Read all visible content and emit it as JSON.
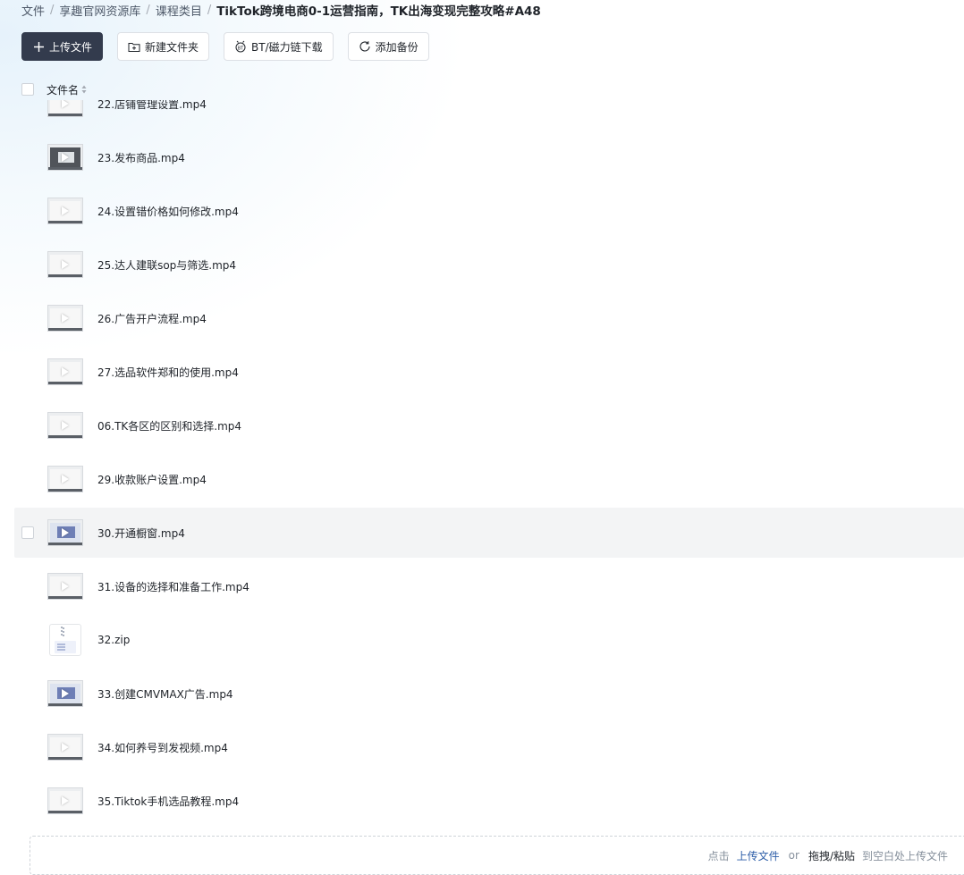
{
  "breadcrumb": {
    "items": [
      "文件",
      "享趣官网资源库",
      "课程类目"
    ],
    "current": "TikTok跨境电商0-1运营指南，TK出海变现完整攻略#A48",
    "separator": "/"
  },
  "toolbar": {
    "upload": "上传文件",
    "new_folder": "新建文件夹",
    "bt_download": "BT/磁力链下载",
    "add_backup": "添加备份"
  },
  "list_header": {
    "name_label": "文件名"
  },
  "files": [
    {
      "name": "22.店铺管理设置.mp4",
      "thumb": "light"
    },
    {
      "name": "23.发布商品.mp4",
      "thumb": "dark"
    },
    {
      "name": "24.设置错价格如何修改.mp4",
      "thumb": "light"
    },
    {
      "name": "25.达人建联sop与筛选.mp4",
      "thumb": "light"
    },
    {
      "name": "26.广告开户流程.mp4",
      "thumb": "light"
    },
    {
      "name": "27.选品软件郑和的使用.mp4",
      "thumb": "light"
    },
    {
      "name": "06.TK各区的区别和选择.mp4",
      "thumb": "light"
    },
    {
      "name": "29.收款账户设置.mp4",
      "thumb": "light"
    },
    {
      "name": "30.开通橱窗.mp4",
      "thumb": "blue"
    },
    {
      "name": "31.设备的选择和准备工作.mp4",
      "thumb": "light"
    },
    {
      "name": "32.zip",
      "thumb": "zip"
    },
    {
      "name": "33.创建CMVMAX广告.mp4",
      "thumb": "blue"
    },
    {
      "name": "34.如何养号到发视频.mp4",
      "thumb": "light"
    },
    {
      "name": "35.Tiktok手机选品教程.mp4",
      "thumb": "light"
    }
  ],
  "dropzone": {
    "prefix": "点击",
    "link": "上传文件",
    "or": "or",
    "drag": "拖拽/粘贴",
    "suffix": "到空白处上传文件"
  },
  "colors": {
    "primary_button": "#333b4d",
    "link": "#2d5ea8",
    "hover_row": "#f3f4f5"
  }
}
